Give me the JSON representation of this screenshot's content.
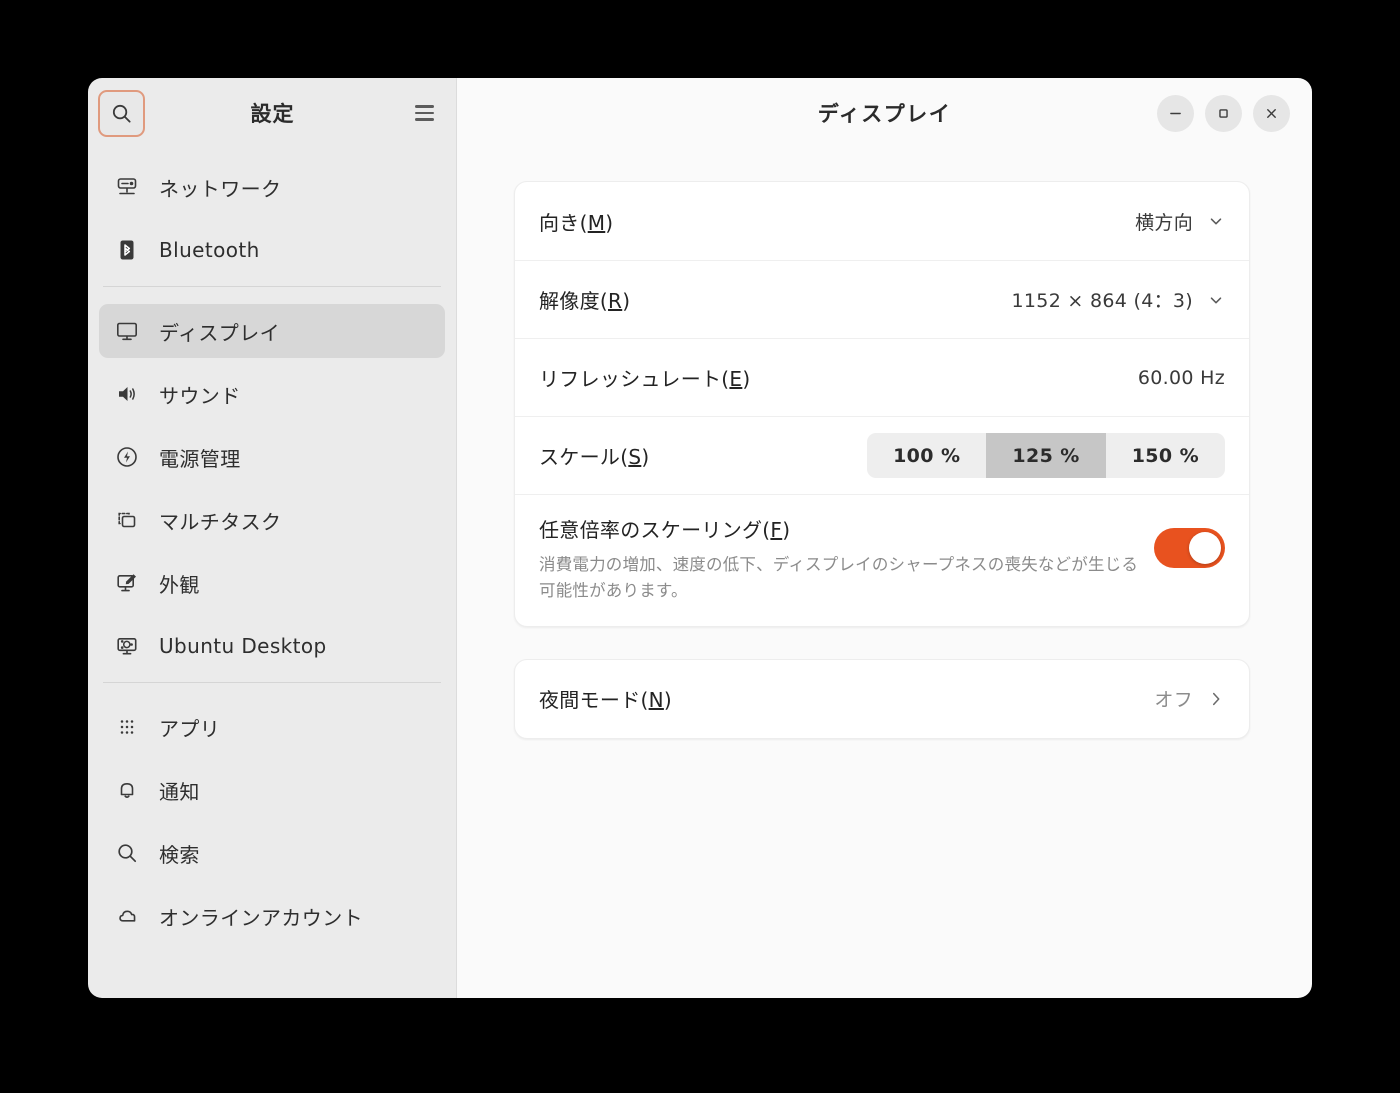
{
  "sidebar": {
    "title": "設定",
    "search_icon": "search-icon",
    "menu_icon": "hamburger-menu-icon",
    "groups": [
      {
        "items": [
          {
            "label": "ネットワーク",
            "icon": "network-icon",
            "selected": false
          },
          {
            "label": "Bluetooth",
            "icon": "bluetooth-icon",
            "selected": false
          }
        ]
      },
      {
        "items": [
          {
            "label": "ディスプレイ",
            "icon": "display-icon",
            "selected": true
          },
          {
            "label": "サウンド",
            "icon": "sound-icon",
            "selected": false
          },
          {
            "label": "電源管理",
            "icon": "power-icon",
            "selected": false
          },
          {
            "label": "マルチタスク",
            "icon": "multitasking-icon",
            "selected": false
          },
          {
            "label": "外観",
            "icon": "appearance-icon",
            "selected": false
          },
          {
            "label": "Ubuntu Desktop",
            "icon": "ubuntu-desktop-icon",
            "selected": false
          }
        ]
      },
      {
        "items": [
          {
            "label": "アプリ",
            "icon": "apps-grid-icon",
            "selected": false
          },
          {
            "label": "通知",
            "icon": "bell-icon",
            "selected": false
          },
          {
            "label": "検索",
            "icon": "search-icon",
            "selected": false
          },
          {
            "label": "オンラインアカウント",
            "icon": "cloud-icon",
            "selected": false
          }
        ]
      }
    ]
  },
  "header": {
    "title": "ディスプレイ",
    "minimize_label": "−",
    "maximize_label": "□",
    "close_label": "×"
  },
  "display_card": {
    "orientation": {
      "label": "向き(",
      "mnemonic": "M",
      "label_end": ")",
      "value": "横方向"
    },
    "resolution": {
      "label": "解像度(",
      "mnemonic": "R",
      "label_end": ")",
      "value": "1152 × 864 (4：3)"
    },
    "refresh_rate": {
      "label": "リフレッシュレート(",
      "mnemonic": "E",
      "label_end": ")",
      "value": "60.00 Hz"
    },
    "scale": {
      "label": "スケール(",
      "mnemonic": "S",
      "label_end": ")",
      "options": [
        "100 %",
        "125 %",
        "150 %"
      ],
      "selected_index": 1
    },
    "fractional_scaling": {
      "label": "任意倍率のスケーリング(",
      "mnemonic": "F",
      "label_end": ")",
      "description": "消費電力の増加、速度の低下、ディスプレイのシャープネスの喪失などが生じる可能性があります。",
      "enabled": true
    }
  },
  "night_light_card": {
    "label": "夜間モード(",
    "mnemonic": "N",
    "label_end": ")",
    "value": "オフ",
    "chevron": "chevron-right-icon"
  },
  "colors": {
    "accent": "#E8521F",
    "sidebar_bg": "#EBEBEB",
    "main_bg": "#FAFAFA",
    "selected_bg": "#D7D7D7",
    "focus_ring": "#E09A7E"
  }
}
